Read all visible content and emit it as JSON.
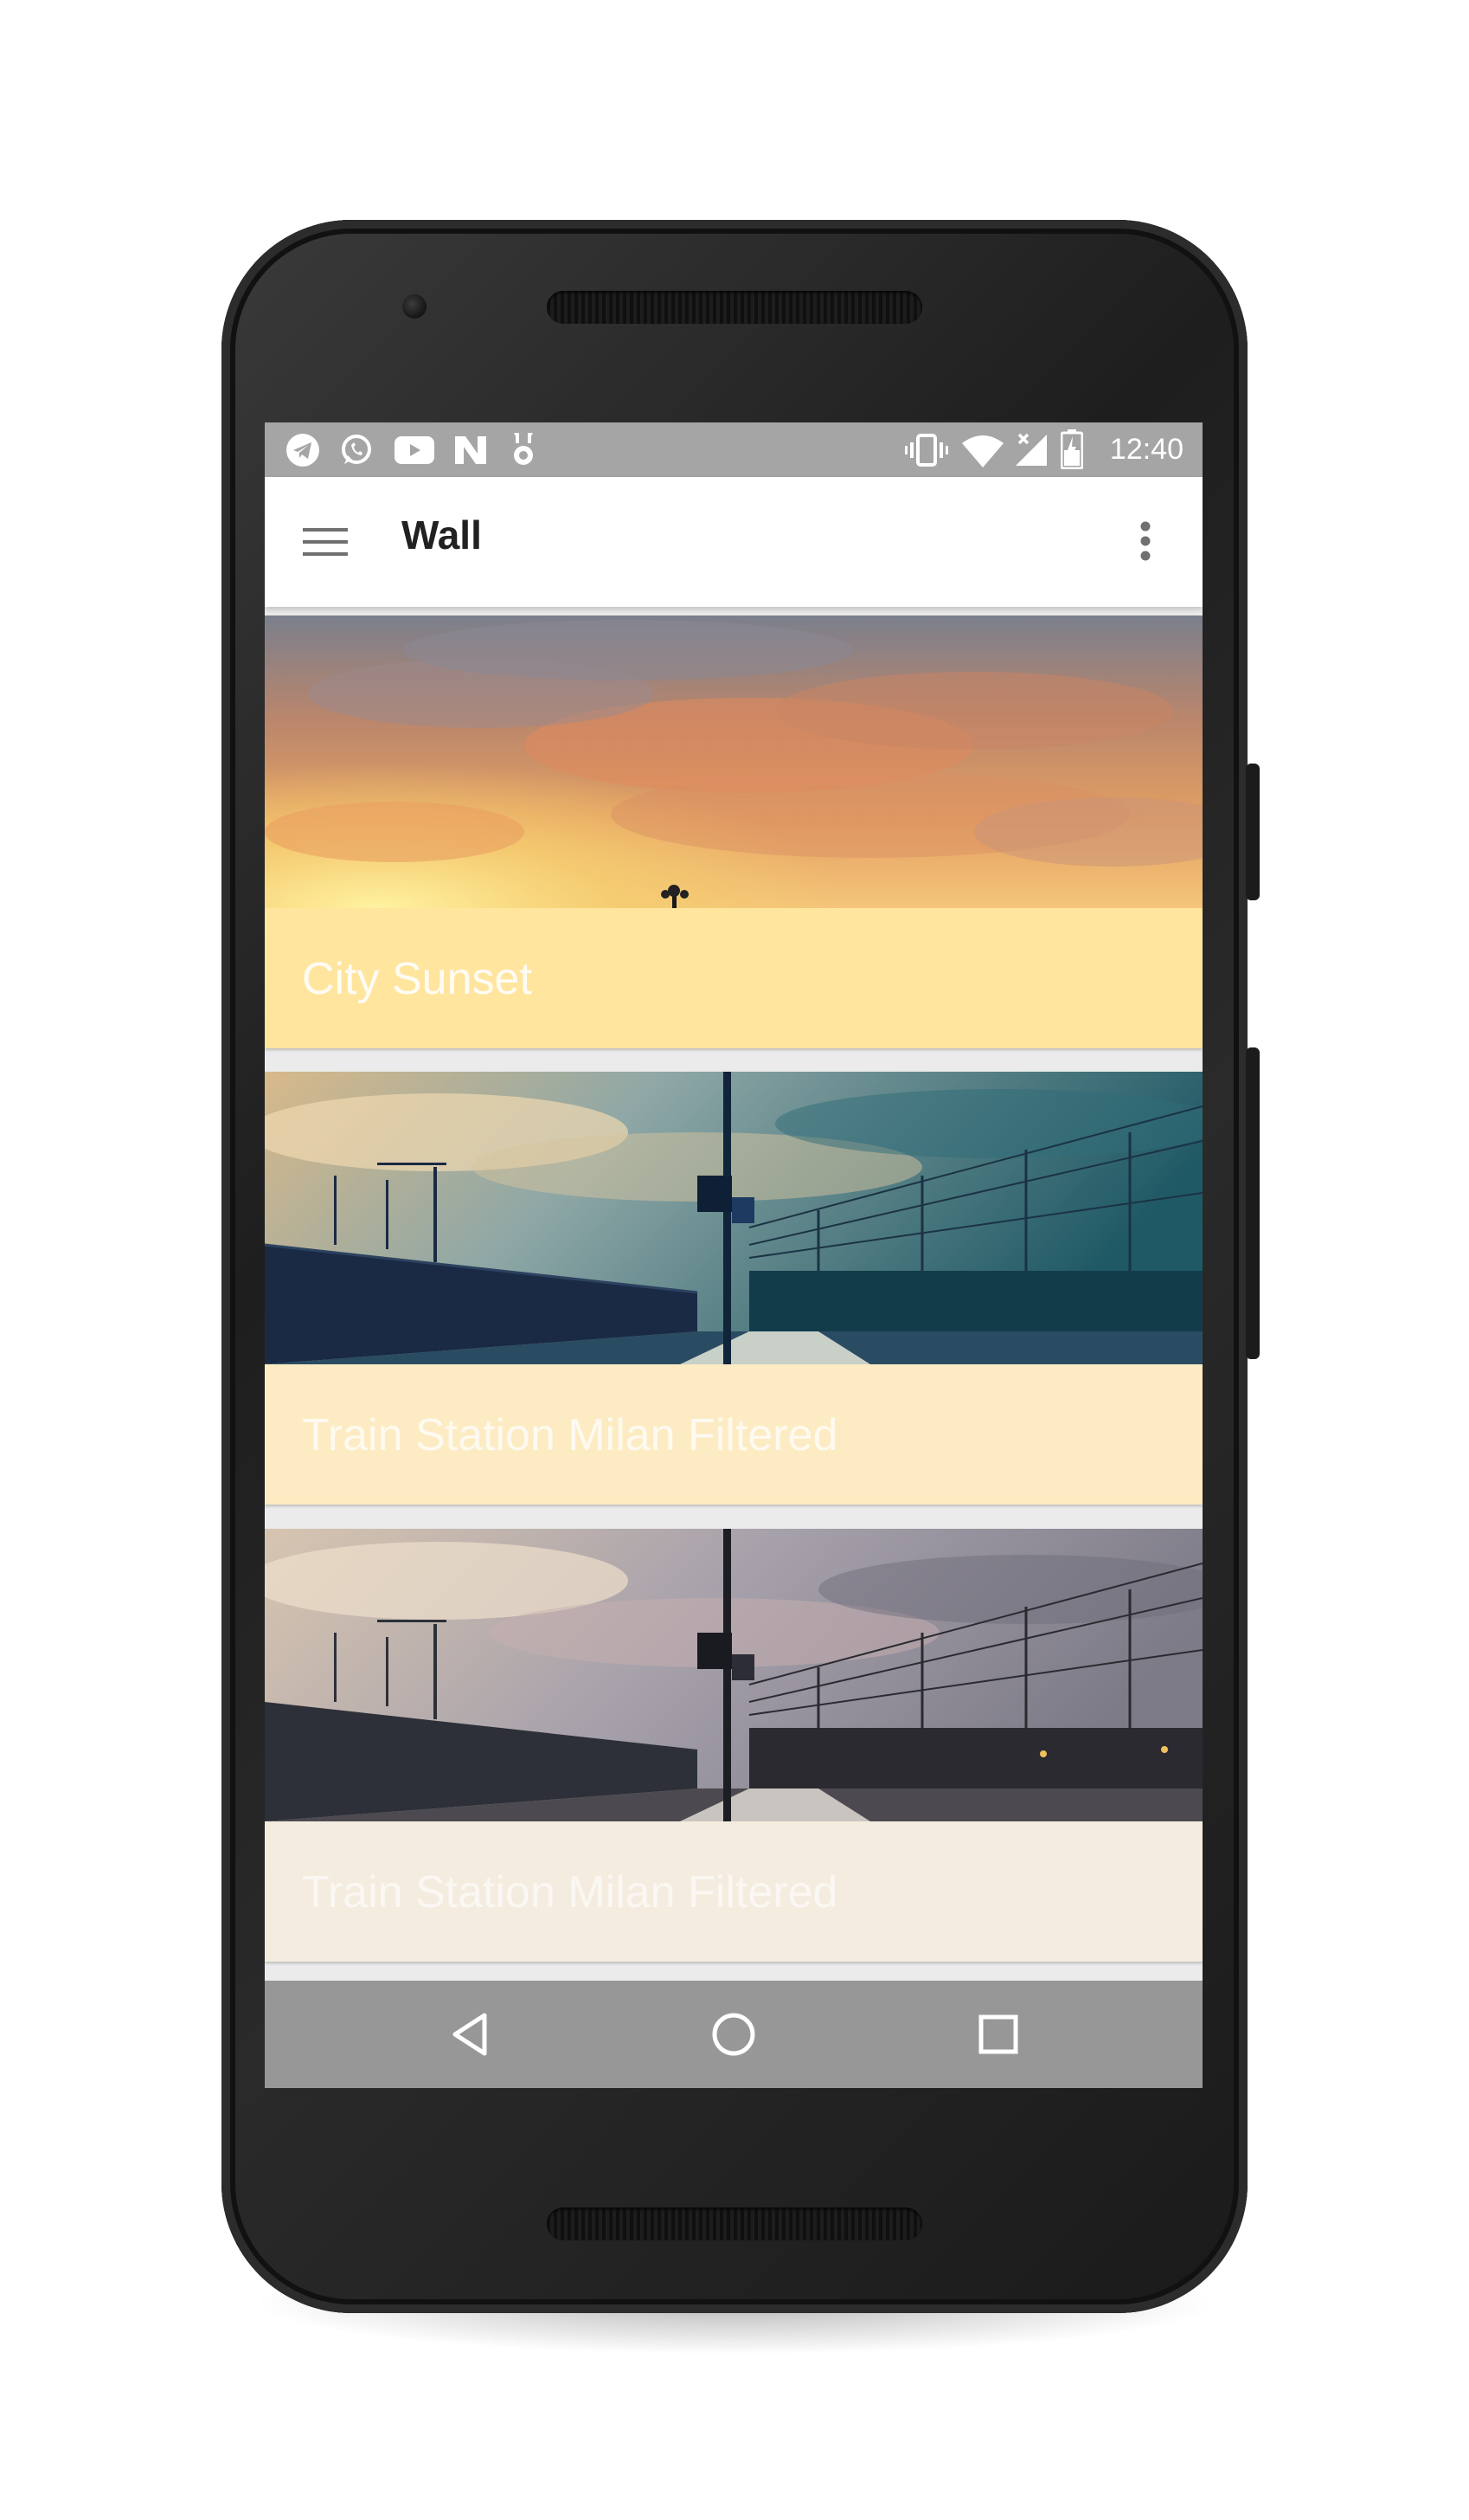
{
  "status_bar": {
    "time": "12:40",
    "left_icons": [
      "telegram-icon",
      "whatsapp-icon",
      "youtube-icon",
      "n-app-icon",
      "notification-bell-icon"
    ],
    "right_icons": [
      "vibrate-icon",
      "wifi-icon",
      "cell-signal-icon",
      "battery-icon"
    ]
  },
  "app_bar": {
    "title": "Wall",
    "menu_icon": "hamburger-menu-icon",
    "overflow_icon": "more-vert-icon"
  },
  "cards": [
    {
      "title": "City Sunset",
      "footer_color": "#ffe59e",
      "title_opacity": 0.9
    },
    {
      "title": "Train Station Milan Filtered",
      "footer_color": "#fdebc3",
      "title_opacity": 0.75
    },
    {
      "title": "Train Station Milan Filtered",
      "footer_color": "#f5ece0",
      "title_opacity": 0.6
    }
  ],
  "nav_bar": {
    "buttons": [
      "back-icon",
      "home-icon",
      "recents-icon"
    ]
  }
}
